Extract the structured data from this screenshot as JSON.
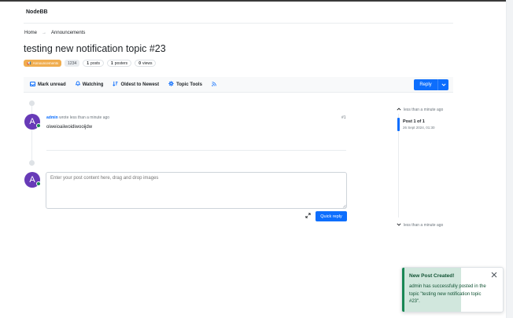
{
  "app": {
    "brand": "NodeBB"
  },
  "breadcrumb": {
    "home": "Home",
    "separator": "→",
    "current": "Announcements"
  },
  "topic": {
    "title": "testing new notification topic #23",
    "category_icon": "📢",
    "category": "Announcements",
    "tid": "1234",
    "posts_count": "1",
    "posts_label": "posts",
    "posters_count": "1",
    "posters_label": "posters",
    "views_count": "0",
    "views_label": "views"
  },
  "toolbar": {
    "mark_unread": "Mark unread",
    "watching": "Watching",
    "sort": "Oldest to Newest",
    "topic_tools": "Topic Tools",
    "reply": "Reply",
    "icons": {
      "mark_unread": "inbox-icon",
      "watching": "bell-icon",
      "sort": "sort-icon",
      "tools": "gear-icon",
      "rss": "rss-icon"
    }
  },
  "post": {
    "avatar_letter": "A",
    "author": "admin",
    "meta_text": "wrote less than a minute ago",
    "index": "#1",
    "content": "oiweioaiiwoidiwooijdw"
  },
  "composer": {
    "avatar_letter": "A",
    "placeholder": "Enter your post content here, drag and drop images",
    "quick_reply": "Quick reply"
  },
  "navigator": {
    "top_time": "less than a minute ago",
    "position": "Post 1 of 1",
    "date": "26 Sept 2024, 01:30",
    "bottom_time": "less than a minute ago"
  },
  "toast": {
    "title": "New Post Created!",
    "body": "admin has successfully posted in the topic \"testing new notification topic #23\"."
  },
  "colors": {
    "primary": "#0d6efd",
    "category": "#f0ad4e",
    "avatar": "#673ab7",
    "online": "#198754",
    "toast_bg": "#d1e7dd",
    "toast_text": "#0f5132"
  }
}
